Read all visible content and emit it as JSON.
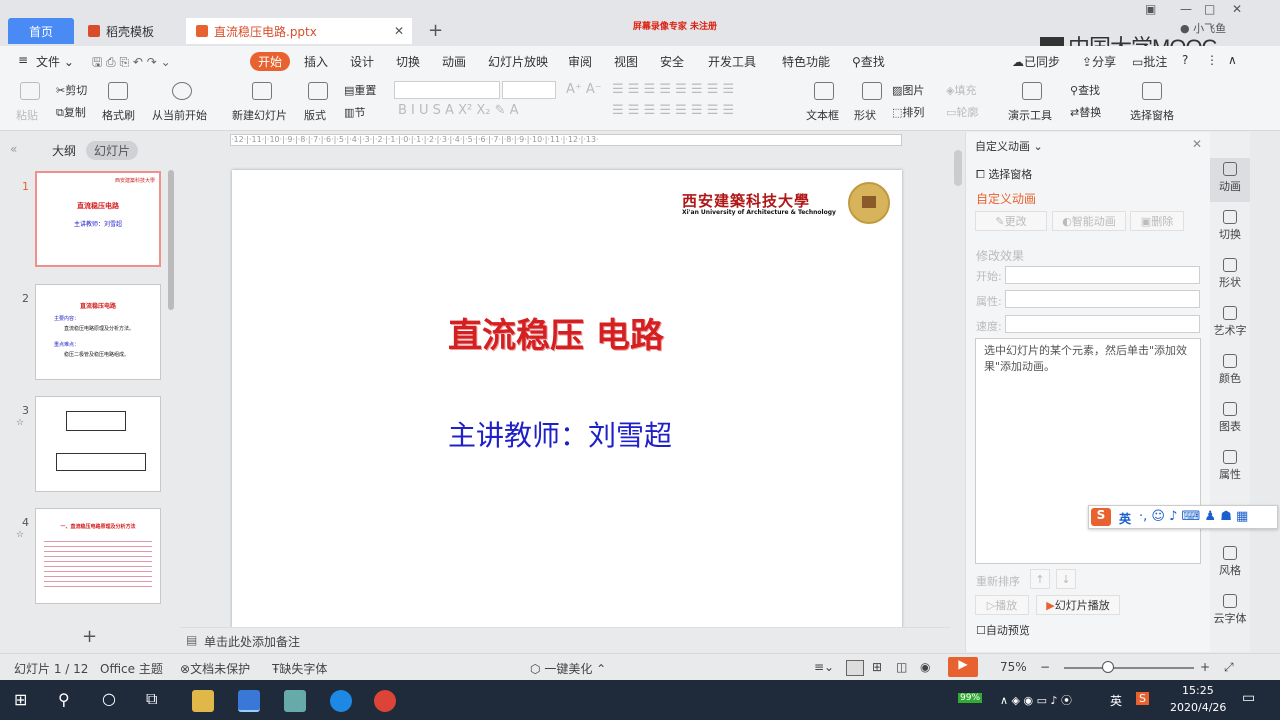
{
  "tabs": {
    "home": "首页",
    "template": "稻壳模板",
    "document": "直流稳压电路.pptx",
    "recorder": "屏幕录像专家 未注册",
    "user": "小飞鱼",
    "watermark": "中国大学MOOC"
  },
  "menu": {
    "file": "文件",
    "items": [
      "开始",
      "插入",
      "设计",
      "切换",
      "动画",
      "幻灯片放映",
      "审阅",
      "视图",
      "安全",
      "开发工具",
      "特色功能"
    ],
    "search": "查找",
    "sync": "已同步",
    "share": "分享",
    "comment": "批注"
  },
  "toolbar": {
    "paste": "粘贴",
    "cut": "剪切",
    "copy": "复制",
    "format_painter": "格式刷",
    "from_current": "从当前开始",
    "new_slide": "新建幻灯片",
    "layout": "版式",
    "reset": "重置",
    "section": "节",
    "textbox": "文本框",
    "shape": "形状",
    "picture": "图片",
    "arrange": "排列",
    "fill": "填充",
    "outline": "轮廓",
    "presentation_tools": "演示工具",
    "find": "查找",
    "replace": "替换",
    "select_pane": "选择窗格"
  },
  "left_panel": {
    "outline_tab": "大纲",
    "slides_tab": "幻灯片",
    "slide_numbers": [
      "1",
      "2",
      "3",
      "4"
    ]
  },
  "thumbs": {
    "t1_title": "直流稳压电路",
    "t1_sub": "主讲教师：刘雪超",
    "t2_title": "直流稳压电路",
    "t2_l1": "主要内容：",
    "t2_l2": "直流稳压电路原理及分析方法。",
    "t2_l3": "重点难点：",
    "t2_l4": "稳压二极管及稳压电路组成。",
    "t4_title": "一、直流稳压电路原理及分析方法"
  },
  "slide": {
    "university_cn": "西安建築科技大學",
    "university_en": "Xi'an University of Architecture & Technology",
    "title": "直流稳压 电路",
    "subtitle": "主讲教师：刘雪超"
  },
  "notes": "单击此处添加备注",
  "anim_panel": {
    "header": "自定义动画",
    "select_pane": "选择窗格",
    "title": "自定义动画",
    "change": "更改",
    "smart": "智能动画",
    "delete": "删除",
    "modify": "修改效果",
    "start": "开始:",
    "property": "属性:",
    "speed": "速度:",
    "hint": "选中幻灯片的某个元素，然后单击\"添加效果\"添加动画。",
    "reorder": "重新排序",
    "play": "播放",
    "slideshow": "幻灯片播放",
    "autopreview": "自动预览"
  },
  "sidebar": [
    "动画",
    "切换",
    "形状",
    "艺术字",
    "颜色",
    "图表",
    "属性",
    "风格",
    "云字体"
  ],
  "status": {
    "slide": "幻灯片 1 / 12",
    "theme": "Office 主题",
    "protect": "文档未保护",
    "missing_font": "缺失字体",
    "beautify": "一键美化",
    "zoom": "75%"
  },
  "taskbar": {
    "time": "15:25",
    "date": "2020/4/26",
    "battery": "99%",
    "ime": "英"
  },
  "colors": {
    "accent": "#e8622f",
    "tab_blue": "#4a8af4",
    "slide_red": "#d42020",
    "slide_blue": "#2020c8"
  }
}
